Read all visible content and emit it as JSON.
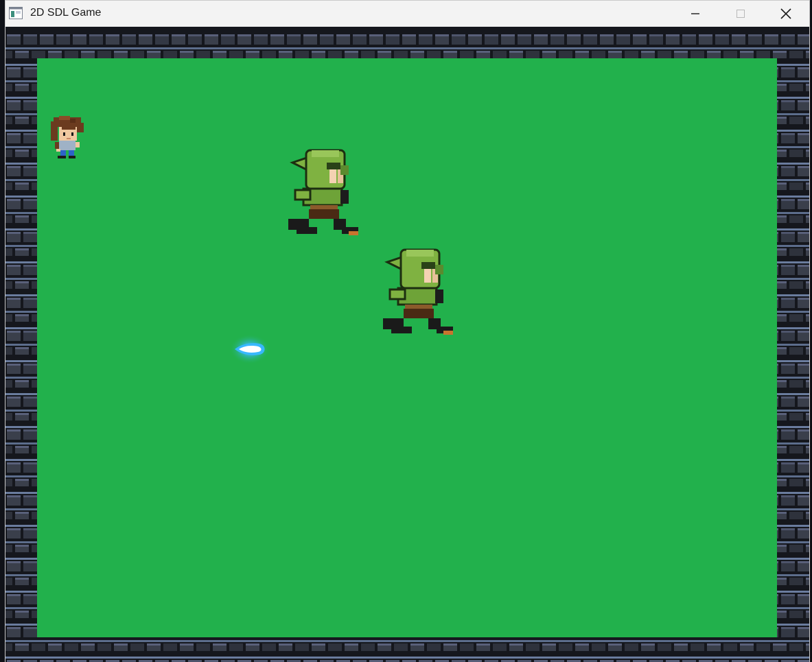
{
  "window": {
    "title": "2D SDL Game",
    "app_icon": "window-app-icon",
    "controls": [
      "minimize-icon",
      "maximize-icon",
      "close-icon"
    ]
  },
  "scene": {
    "background_color": "#22b14c",
    "wall": "stone-brick-border",
    "wall_colors": {
      "brick": "#3a3f4b",
      "brick_light": "#59607a",
      "mortar": "#6a7c9e",
      "dark": "#15171d"
    },
    "entities": [
      {
        "type": "player",
        "sprite": "brown-haired-hero"
      },
      {
        "type": "enemy",
        "sprite": "green-goblin-running"
      },
      {
        "type": "enemy",
        "sprite": "green-goblin-running"
      },
      {
        "type": "projectile",
        "sprite": "blue-energy-bolt",
        "color": "#38b8ff"
      }
    ]
  }
}
